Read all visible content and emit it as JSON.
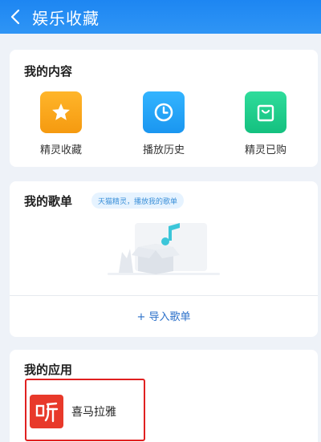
{
  "header": {
    "title": "娱乐收藏",
    "back_icon": "chevron-left-icon",
    "bg_color": "#1d86f2"
  },
  "my_content": {
    "title": "我的内容",
    "items": [
      {
        "label": "精灵收藏",
        "icon": "star-icon",
        "color": "#f5a31a"
      },
      {
        "label": "播放历史",
        "icon": "clock-icon",
        "color": "#1a9cf0"
      },
      {
        "label": "精灵已购",
        "icon": "shopping-bag-icon",
        "color": "#1ec98a"
      }
    ]
  },
  "my_playlist": {
    "title": "我的歌单",
    "tag": "天猫精灵，播放我的歌单",
    "empty_icon": "empty-box-music-icon",
    "import_label": "+ 导入歌单"
  },
  "my_apps": {
    "title": "我的应用",
    "apps": [
      {
        "label": "喜马拉雅",
        "icon": "ximalaya-logo-icon",
        "color": "#e8392a"
      }
    ]
  }
}
